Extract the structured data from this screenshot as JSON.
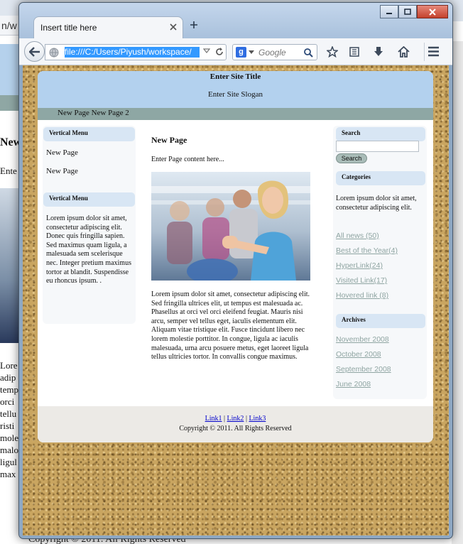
{
  "background_window": {
    "address_fragment": "n/w",
    "page_title": "New",
    "content_fragment": "Ente",
    "body_lines": [
      "Lore",
      "adip",
      "temp",
      "orci",
      "tellu",
      "risti",
      "mole",
      "malo",
      "ligul",
      "max"
    ],
    "copyright": "Copyright © 2011. All Rights Reserved"
  },
  "browser": {
    "tab_title": "Insert title here",
    "url": "file:///C:/Users/Piyush/workspace/",
    "search_placeholder": "Google",
    "search_engine_letter": "g"
  },
  "site": {
    "title": "Enter Site Title",
    "slogan": "Enter Site Slogan",
    "nav": [
      "New Page",
      "New Page 2"
    ],
    "left_menu": {
      "title": "Vertical Menu",
      "items": [
        "New Page",
        "New Page"
      ],
      "second_title": "Vertical Menu",
      "lorem": "Lorem ipsum dolor sit amet, consectetur adipiscing elit. Donec quis fringilla sapien. Sed maximus quam ligula, a malesuada sem scelerisque nec. Integer pretium maximus tortor at blandit. Suspendisse eu rhoncus ipsum. ."
    },
    "main": {
      "page_title": "New Page",
      "intro": "Enter Page content here...",
      "body": "Lorem ipsum dolor sit amet, consectetur adipiscing elit. Sed fringilla ultrices elit, ut tempus est malesuada ac. Phasellus at orci vel orci eleifend feugiat. Mauris nisi arcu, semper vel tellus eget, iaculis elementum elit. Aliquam vitae tristique elit. Fusce tincidunt libero nec lorem molestie porttitor. In congue, ligula ac iaculis malesuada, urna arcu posuere metus, eget laoreet ligula tellus ultricies tortor. In convallis congue maximus."
    },
    "right": {
      "search_title": "Search",
      "search_button": "Search",
      "categories_title": "Categories",
      "categories_text": "Lorem ipsum dolor sit amet, consectetur adipiscing elit.",
      "category_links": [
        "All news (50)",
        "Best of the Year(4)",
        "HyperLink(24)",
        "Visited Link(17)",
        "Hovered link (8)"
      ],
      "archives_title": "Archives",
      "archive_links": [
        "November 2008",
        "October 2008",
        "September 2008",
        "June 2008"
      ]
    },
    "footer": {
      "links": [
        "Link1",
        "Link2",
        "Link3"
      ],
      "separator": " | ",
      "copyright": "Copyright © 2011. All Rights Reserved"
    }
  },
  "colors": {
    "header_bg": "#b3d1ee",
    "nav_bg": "#8ea7a4",
    "box_title_bg": "#d8e6f4",
    "sidebar_link": "#8fa5a2",
    "footer_bg": "#eceae6",
    "cork_bg": "#c9a560"
  },
  "icons": [
    "back-arrow-icon",
    "globe-icon",
    "dropdown-icon",
    "reload-icon",
    "search-icon",
    "star-icon",
    "bookmarks-icon",
    "download-icon",
    "home-icon",
    "menu-icon",
    "minimize-icon",
    "maximize-icon",
    "close-icon",
    "new-tab-icon"
  ]
}
